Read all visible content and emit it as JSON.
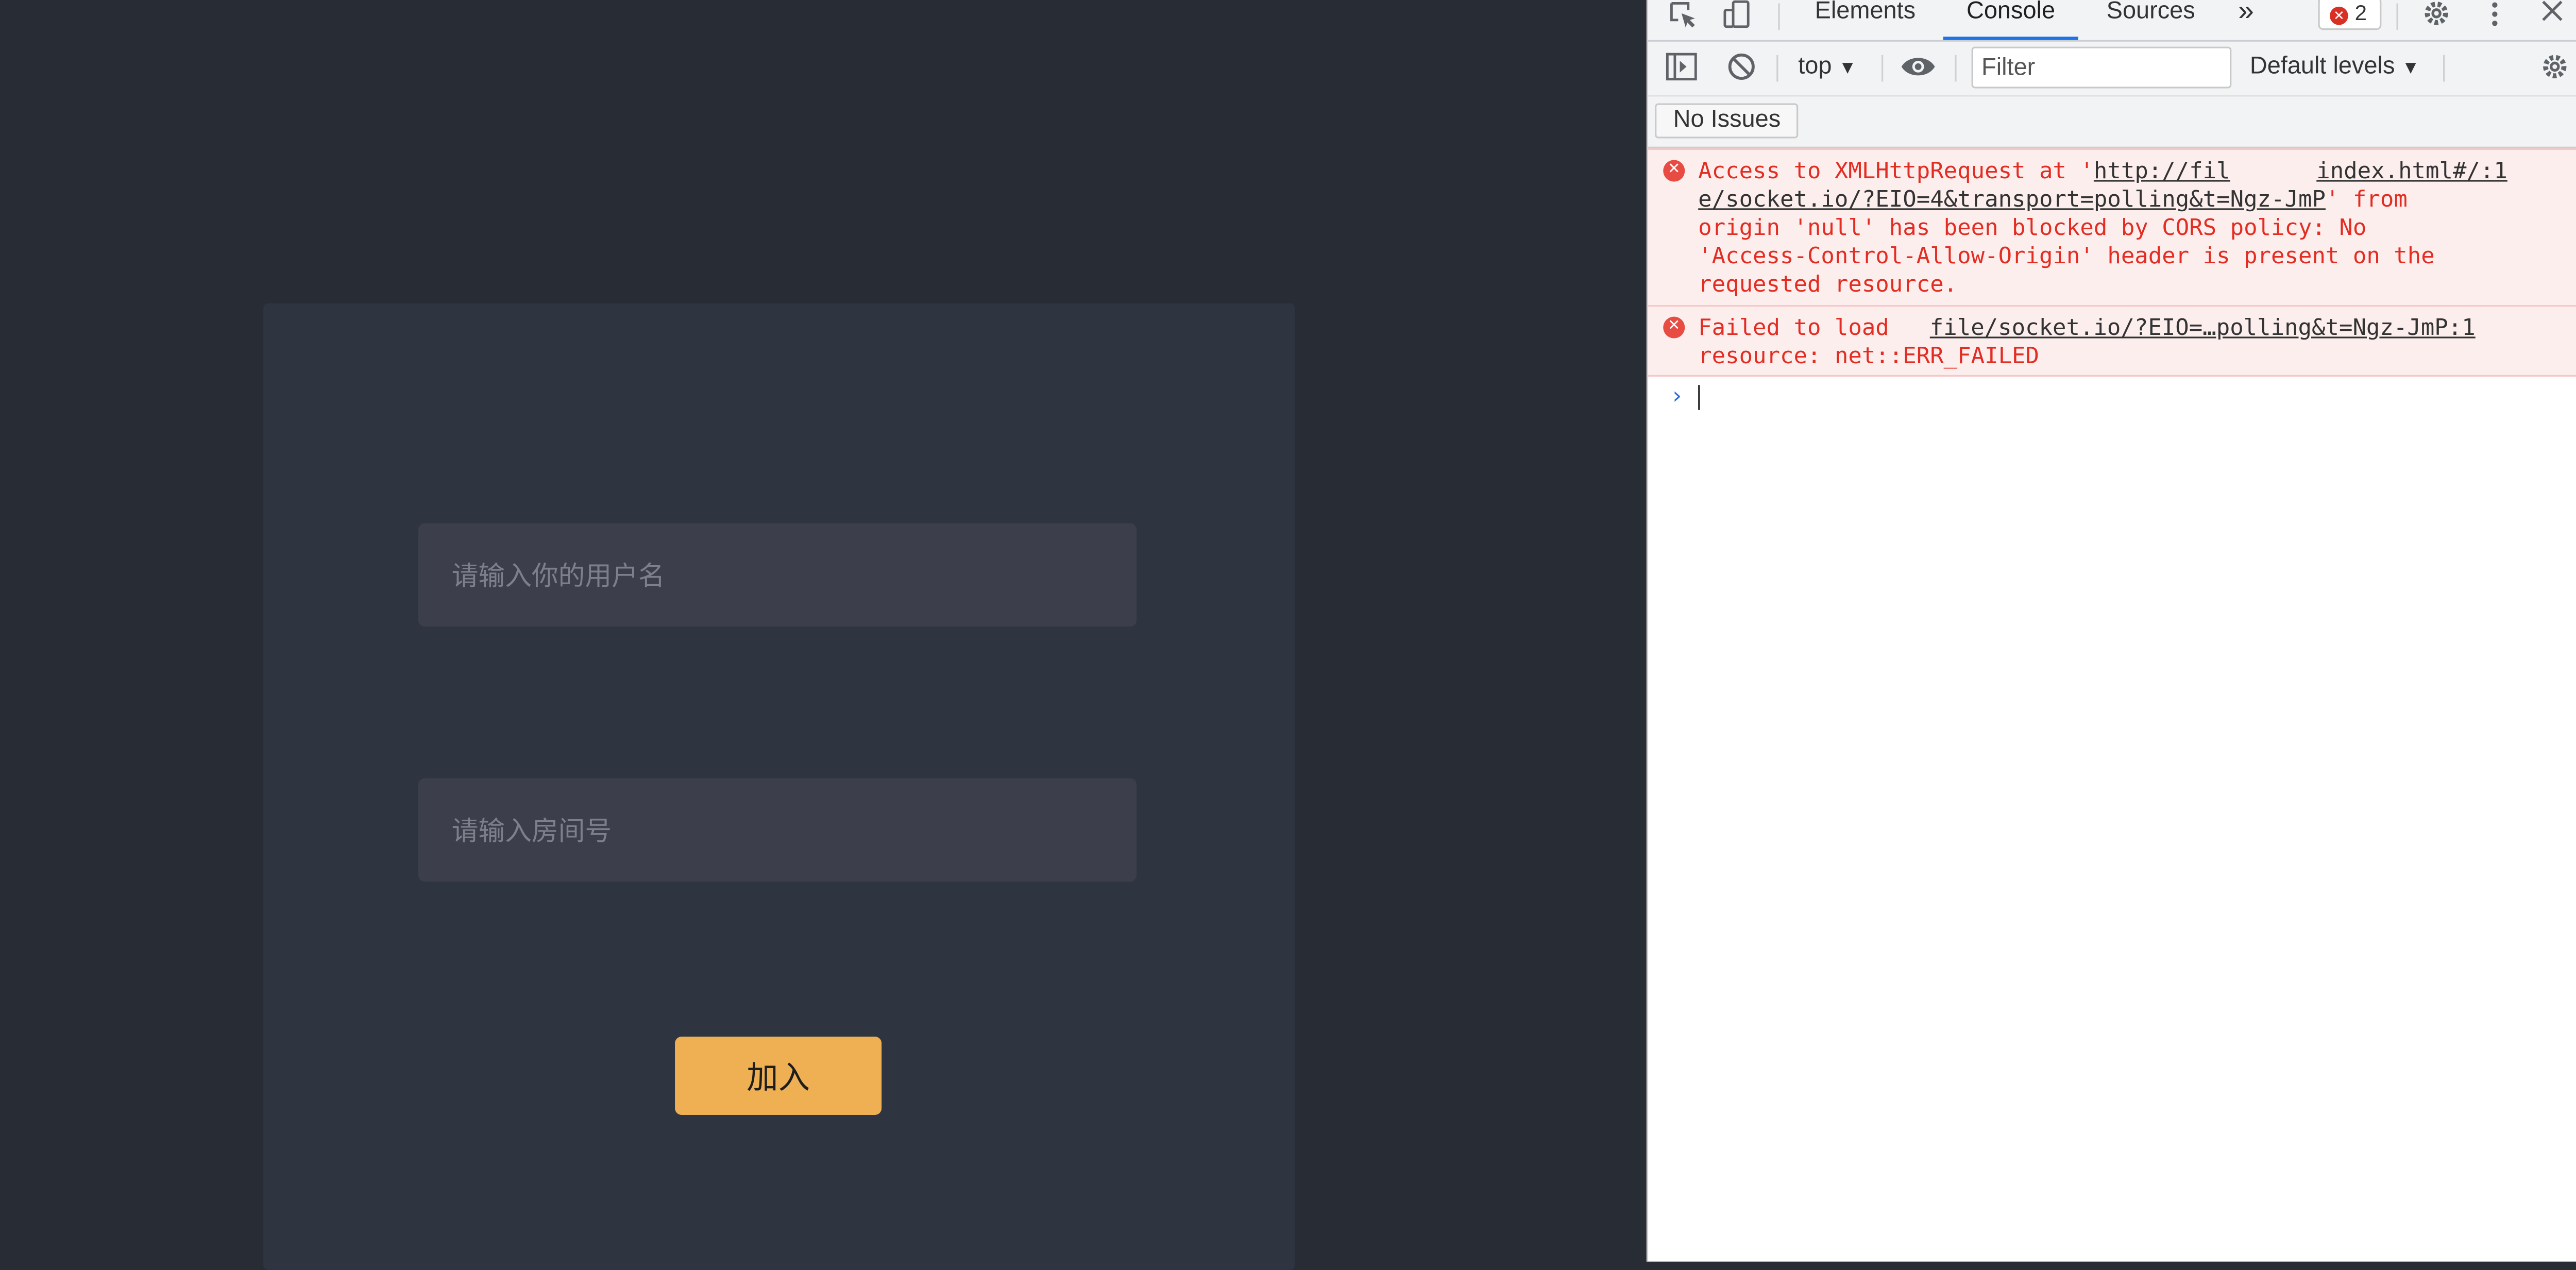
{
  "app": {
    "username_placeholder": "请输入你的用户名",
    "room_placeholder": "请输入房间号",
    "join_label": "加入",
    "colors": {
      "background": "#282c34",
      "card": "#2e3440",
      "input": "#3c3f4b",
      "button": "#efb054"
    }
  },
  "devtools": {
    "tabs": [
      "Elements",
      "Console",
      "Sources"
    ],
    "active_tab": "Console",
    "more_tabs_icon": "»",
    "error_count": "2",
    "context": "top",
    "filter_placeholder": "Filter",
    "levels": "Default levels",
    "issues_label": "No Issues",
    "messages": [
      {
        "lines": [
          {
            "pre": "Access to XMLHttpRequest at '",
            "url": "http://fil"
          },
          {
            "url": "e/socket.io/?EIO=4&transport=polling&t=Ngz-JmP",
            "post": "' from"
          },
          {
            "pre": "origin 'null' has been blocked by CORS policy: No"
          },
          {
            "pre": "'Access-Control-Allow-Origin' header is present on the"
          },
          {
            "pre": "requested resource."
          }
        ],
        "source": "index.html#/:1"
      },
      {
        "lines": [
          {
            "pre": "Failed to load "
          },
          {
            "pre": "resource: net::ERR_FAILED"
          }
        ],
        "source": "file/socket.io/?EIO=…polling&t=Ngz-JmP:1"
      }
    ],
    "prompt": "›",
    "colors": {
      "error_text": "#e32d22",
      "error_bg": "#fdeeee",
      "accent": "#1a73e8"
    }
  }
}
